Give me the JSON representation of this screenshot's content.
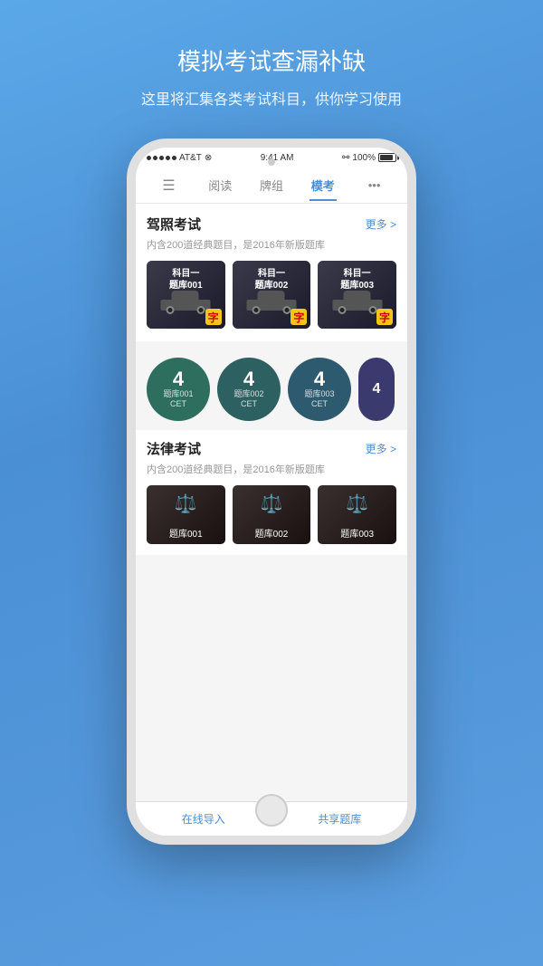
{
  "page": {
    "background_gradient": "linear-gradient(160deg, #5ba8e8, #4a8fd4)",
    "title": "模拟考试查漏补缺",
    "subtitle": "这里将汇集各类考试科目，供你学习使用"
  },
  "status_bar": {
    "carrier": "AT&T",
    "wifi": true,
    "time": "9:41 AM",
    "battery": "100%"
  },
  "nav_tabs": [
    {
      "label": "≡",
      "type": "icon",
      "active": false
    },
    {
      "label": "阅读",
      "active": false
    },
    {
      "label": "牌组",
      "active": false
    },
    {
      "label": "模考",
      "active": true
    },
    {
      "label": "•••",
      "type": "dots",
      "active": false
    }
  ],
  "driving_section": {
    "title": "驾照考试",
    "more_label": "更多 >",
    "subtitle": "内含200道经典题目，是2016年新版题库",
    "cards": [
      {
        "subject": "科目一",
        "bank": "题库001",
        "badge": "字"
      },
      {
        "subject": "科目一",
        "bank": "题库002",
        "badge": "字"
      },
      {
        "subject": "科目一",
        "bank": "题库003",
        "badge": "字"
      }
    ]
  },
  "cet_section": {
    "cards": [
      {
        "number": "4",
        "bank": "题库001",
        "suffix": "CET"
      },
      {
        "number": "4",
        "bank": "题库002",
        "suffix": "CET"
      },
      {
        "number": "4",
        "bank": "题库003",
        "suffix": "CET"
      }
    ]
  },
  "law_section": {
    "title": "法律考试",
    "more_label": "更多 >",
    "subtitle": "内含200道经典题目，是2016年新版题库",
    "cards": [
      {
        "bank": "题库001"
      },
      {
        "bank": "题库002"
      },
      {
        "bank": "题库003"
      }
    ]
  },
  "bottom_bar": {
    "left": "在线导入",
    "right": "共享题库"
  }
}
